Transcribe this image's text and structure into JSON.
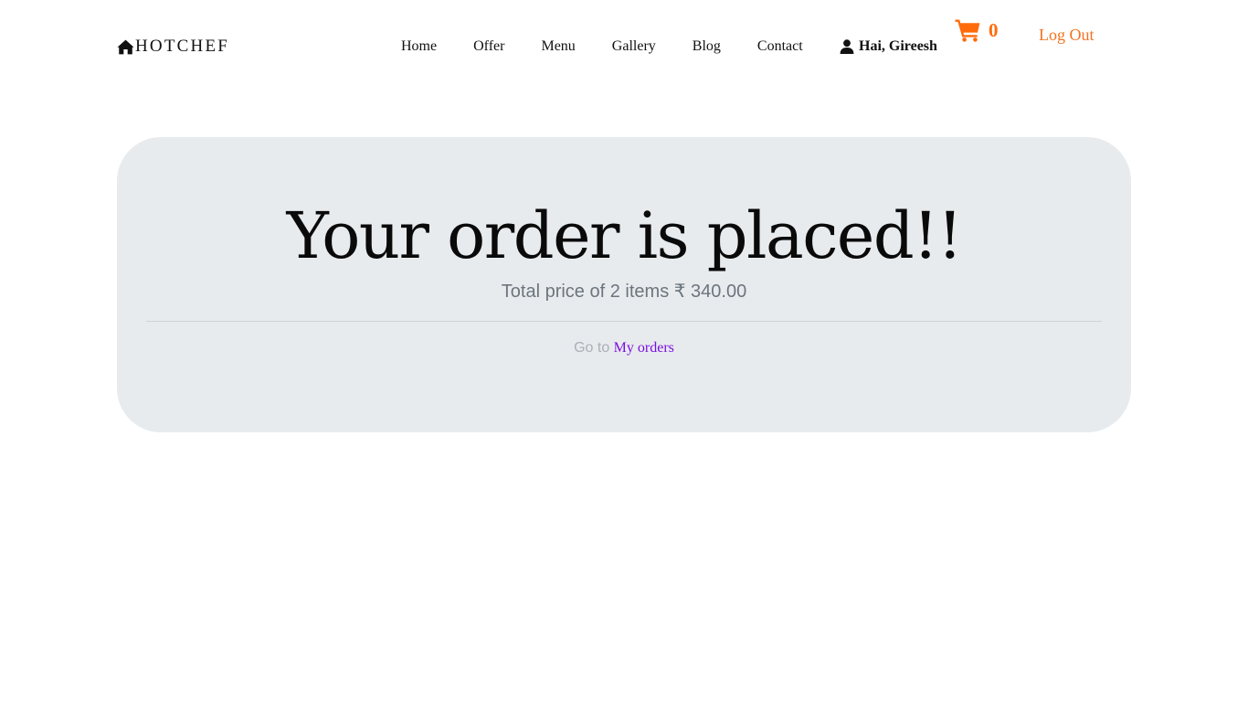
{
  "header": {
    "brand": {
      "name": "HOTCHEF",
      "icon": "home-icon"
    },
    "nav": {
      "items": [
        {
          "label": "Home"
        },
        {
          "label": "Offer"
        },
        {
          "label": "Menu"
        },
        {
          "label": "Gallery"
        },
        {
          "label": "Blog"
        },
        {
          "label": "Contact"
        }
      ]
    },
    "user": {
      "greeting": "Hai, Gireesh",
      "icon": "user-icon"
    },
    "cart": {
      "count": "0",
      "icon": "shopping-cart-icon",
      "color": "#ff6b0a"
    },
    "logout": {
      "label": "Log Out",
      "color": "#f27321"
    }
  },
  "confirmation": {
    "title": "Your order is placed!!",
    "subtitle": "Total price of 2 items ₹ 340.00",
    "goto_text": "Go to",
    "orders_link": "My orders",
    "link_color": "#7a0fe0",
    "card_background": "#e8ebee"
  }
}
